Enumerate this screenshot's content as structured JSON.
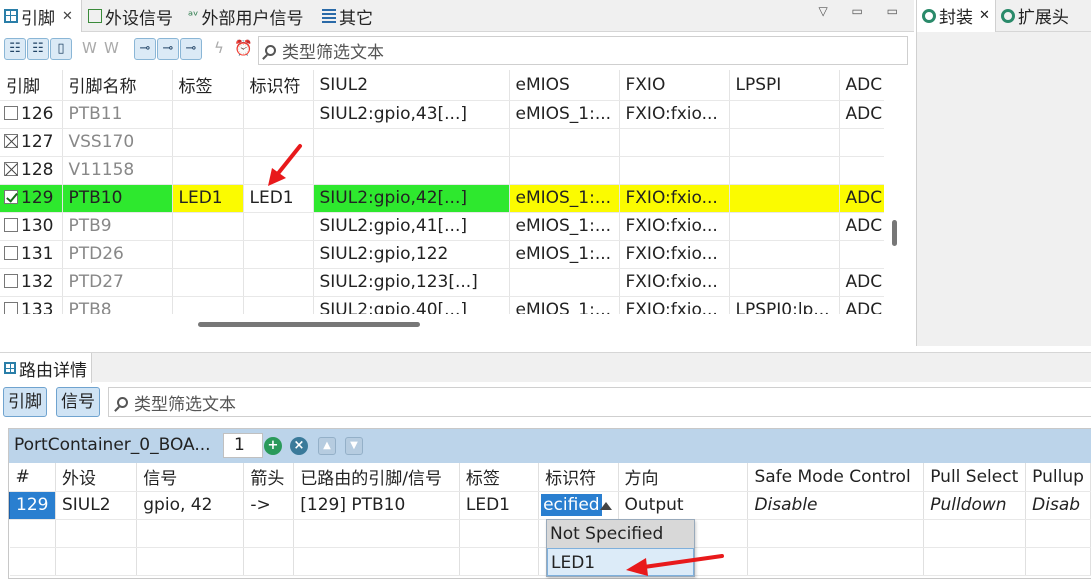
{
  "top_tabs": [
    {
      "label": "引脚",
      "icon": "grid-icon",
      "closable": true
    },
    {
      "label": "外设信号",
      "icon": "wave-icon"
    },
    {
      "label": "外部用户信号",
      "icon": "signal-icon"
    },
    {
      "label": "其它",
      "icon": "list-icon"
    }
  ],
  "window_buttons": "▽ ▭ ▭",
  "toolbar": {
    "filter_placeholder": "类型筛选文本"
  },
  "pin_table": {
    "columns": [
      "引脚",
      "引脚名称",
      "标签",
      "标识符",
      "SIUL2",
      "eMIOS",
      "FXIO",
      "LPSPI",
      "ADC"
    ],
    "rows": [
      {
        "check": "empty",
        "pin": "126",
        "name": "PTB11",
        "label": "",
        "ident": "",
        "siul2": "SIUL2:gpio,43[...]",
        "emios": "eMIOS_1:...",
        "fxio": "FXIO:fxio...",
        "lpspi": "",
        "adc": "ADC"
      },
      {
        "check": "x",
        "pin": "127",
        "name": "VSS170",
        "label": "",
        "ident": "",
        "siul2": "",
        "emios": "",
        "fxio": "",
        "lpspi": "",
        "adc": ""
      },
      {
        "check": "x",
        "pin": "128",
        "name": "V11158",
        "label": "",
        "ident": "",
        "siul2": "",
        "emios": "",
        "fxio": "",
        "lpspi": "",
        "adc": ""
      },
      {
        "check": "checked",
        "pin": "129",
        "name": "PTB10",
        "label": "LED1",
        "ident": "LED1",
        "siul2": "SIUL2:gpio,42[...]",
        "emios": "eMIOS_1:...",
        "fxio": "FXIO:fxio...",
        "lpspi": "",
        "adc": "ADC"
      },
      {
        "check": "empty",
        "pin": "130",
        "name": "PTB9",
        "label": "",
        "ident": "",
        "siul2": "SIUL2:gpio,41[...]",
        "emios": "eMIOS_1:...",
        "fxio": "FXIO:fxio...",
        "lpspi": "",
        "adc": "ADC"
      },
      {
        "check": "empty",
        "pin": "131",
        "name": "PTD26",
        "label": "",
        "ident": "",
        "siul2": "SIUL2:gpio,122",
        "emios": "eMIOS_1:...",
        "fxio": "FXIO:fxio...",
        "lpspi": "",
        "adc": ""
      },
      {
        "check": "empty",
        "pin": "132",
        "name": "PTD27",
        "label": "",
        "ident": "",
        "siul2": "SIUL2:gpio,123[...]",
        "emios": "",
        "fxio": "FXIO:fxio...",
        "lpspi": "",
        "adc": "ADC"
      },
      {
        "check": "empty",
        "pin": "133",
        "name": "PTB8",
        "label": "",
        "ident": "",
        "siul2": "SIUL2:gpio,40[...]",
        "emios": "eMIOS_1:...",
        "fxio": "FXIO:fxio...",
        "lpspi": "LPSPI0:lp...",
        "adc": "ADC"
      }
    ]
  },
  "right_tabs": [
    {
      "label": "封装",
      "icon": "gear-icon",
      "closable": true
    },
    {
      "label": "扩展头",
      "icon": "gear-icon"
    }
  ],
  "bottom": {
    "tab_label": "路由详情",
    "seg_pin": "引脚",
    "seg_signal": "信号",
    "filter_placeholder": "类型筛选文本",
    "container_title": "PortContainer_0_BOA...",
    "container_count": "1",
    "columns": [
      "#",
      "外设",
      "信号",
      "箭头",
      "已路由的引脚/信号",
      "标签",
      "标识符",
      "方向",
      "Safe Mode Control",
      "Pull Select",
      "Pullup"
    ],
    "row": {
      "num": "129",
      "peripheral": "SIUL2",
      "signal": "gpio, 42",
      "arrow": "->",
      "routed": "[129] PTB10",
      "label": "LED1",
      "ident": "ecified",
      "direction": "Output",
      "safe_mode": "Disable",
      "pull_select": "Pulldown",
      "pullup": "Disab"
    },
    "dropdown": [
      "Not Specified",
      "LED1"
    ]
  },
  "colors": {
    "green": "#2ee82e",
    "yellow": "#fbfb00",
    "selection_blue": "#2a7fd0",
    "arrow_red": "#e8191b"
  }
}
